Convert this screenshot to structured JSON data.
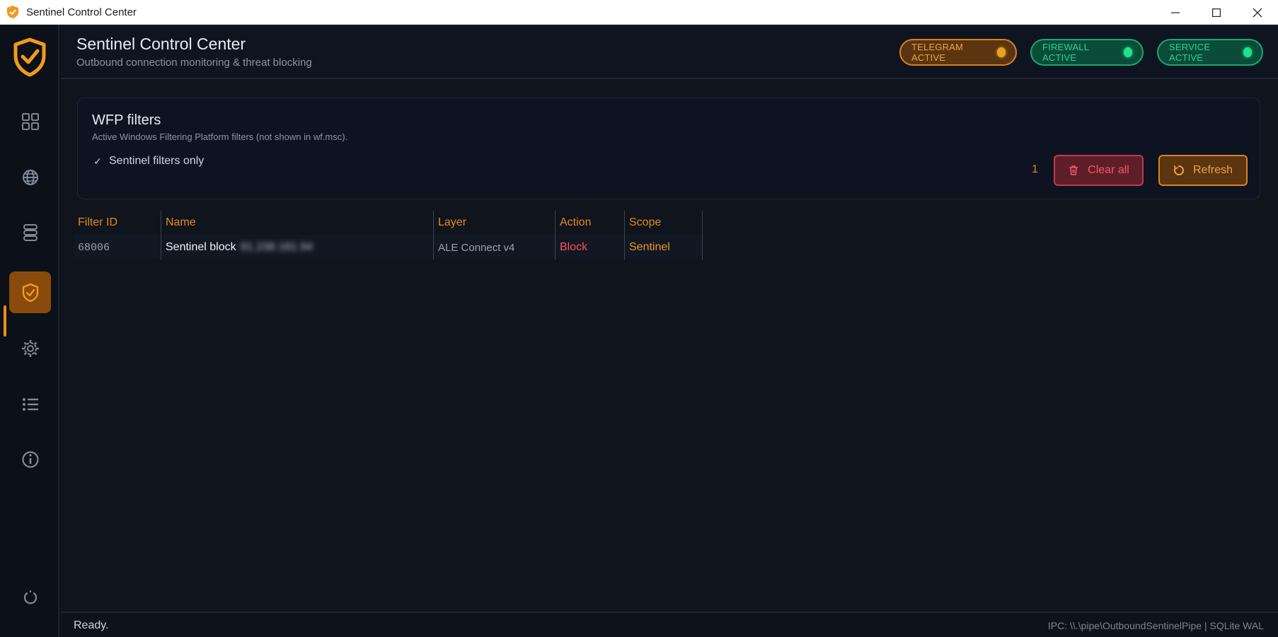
{
  "window": {
    "title": "Sentinel Control Center"
  },
  "header": {
    "title": "Sentinel Control Center",
    "subtitle": "Outbound connection monitoring & threat blocking",
    "badges": {
      "telegram": "TELEGRAM ACTIVE",
      "firewall": "FIREWALL ACTIVE",
      "service": "SERVICE ACTIVE"
    }
  },
  "sidebar": {
    "items": [
      {
        "icon": "dashboard-grid-icon"
      },
      {
        "icon": "globe-icon"
      },
      {
        "icon": "database-icon"
      },
      {
        "icon": "shield-check-icon",
        "active": true
      },
      {
        "icon": "gear-icon"
      },
      {
        "icon": "list-icon"
      },
      {
        "icon": "info-icon"
      },
      {
        "icon": "power-icon"
      }
    ]
  },
  "filters": {
    "title": "WFP filters",
    "subtitle": "Active Windows Filtering Platform filters (not shown in wf.msc).",
    "checkbox_label": "Sentinel filters only",
    "checkbox_checked": true,
    "count": "1",
    "clear_label": "Clear all",
    "refresh_label": "Refresh"
  },
  "table": {
    "columns": [
      "Filter ID",
      "Name",
      "Layer",
      "Action",
      "Scope"
    ],
    "rows": [
      {
        "id": "68006",
        "name": "Sentinel block",
        "name_blurred": "91.238.181.94",
        "layer": "ALE Connect v4",
        "action": "Block",
        "scope": "Sentinel"
      }
    ]
  },
  "status": {
    "left": "Ready.",
    "right": "IPC: \\\\.\\pipe\\OutboundSentinelPipe | SQLite WAL"
  },
  "colors": {
    "accent": "#f08c1a",
    "success": "#22e08a",
    "danger": "#ef5a6b",
    "background": "#0f141d"
  }
}
